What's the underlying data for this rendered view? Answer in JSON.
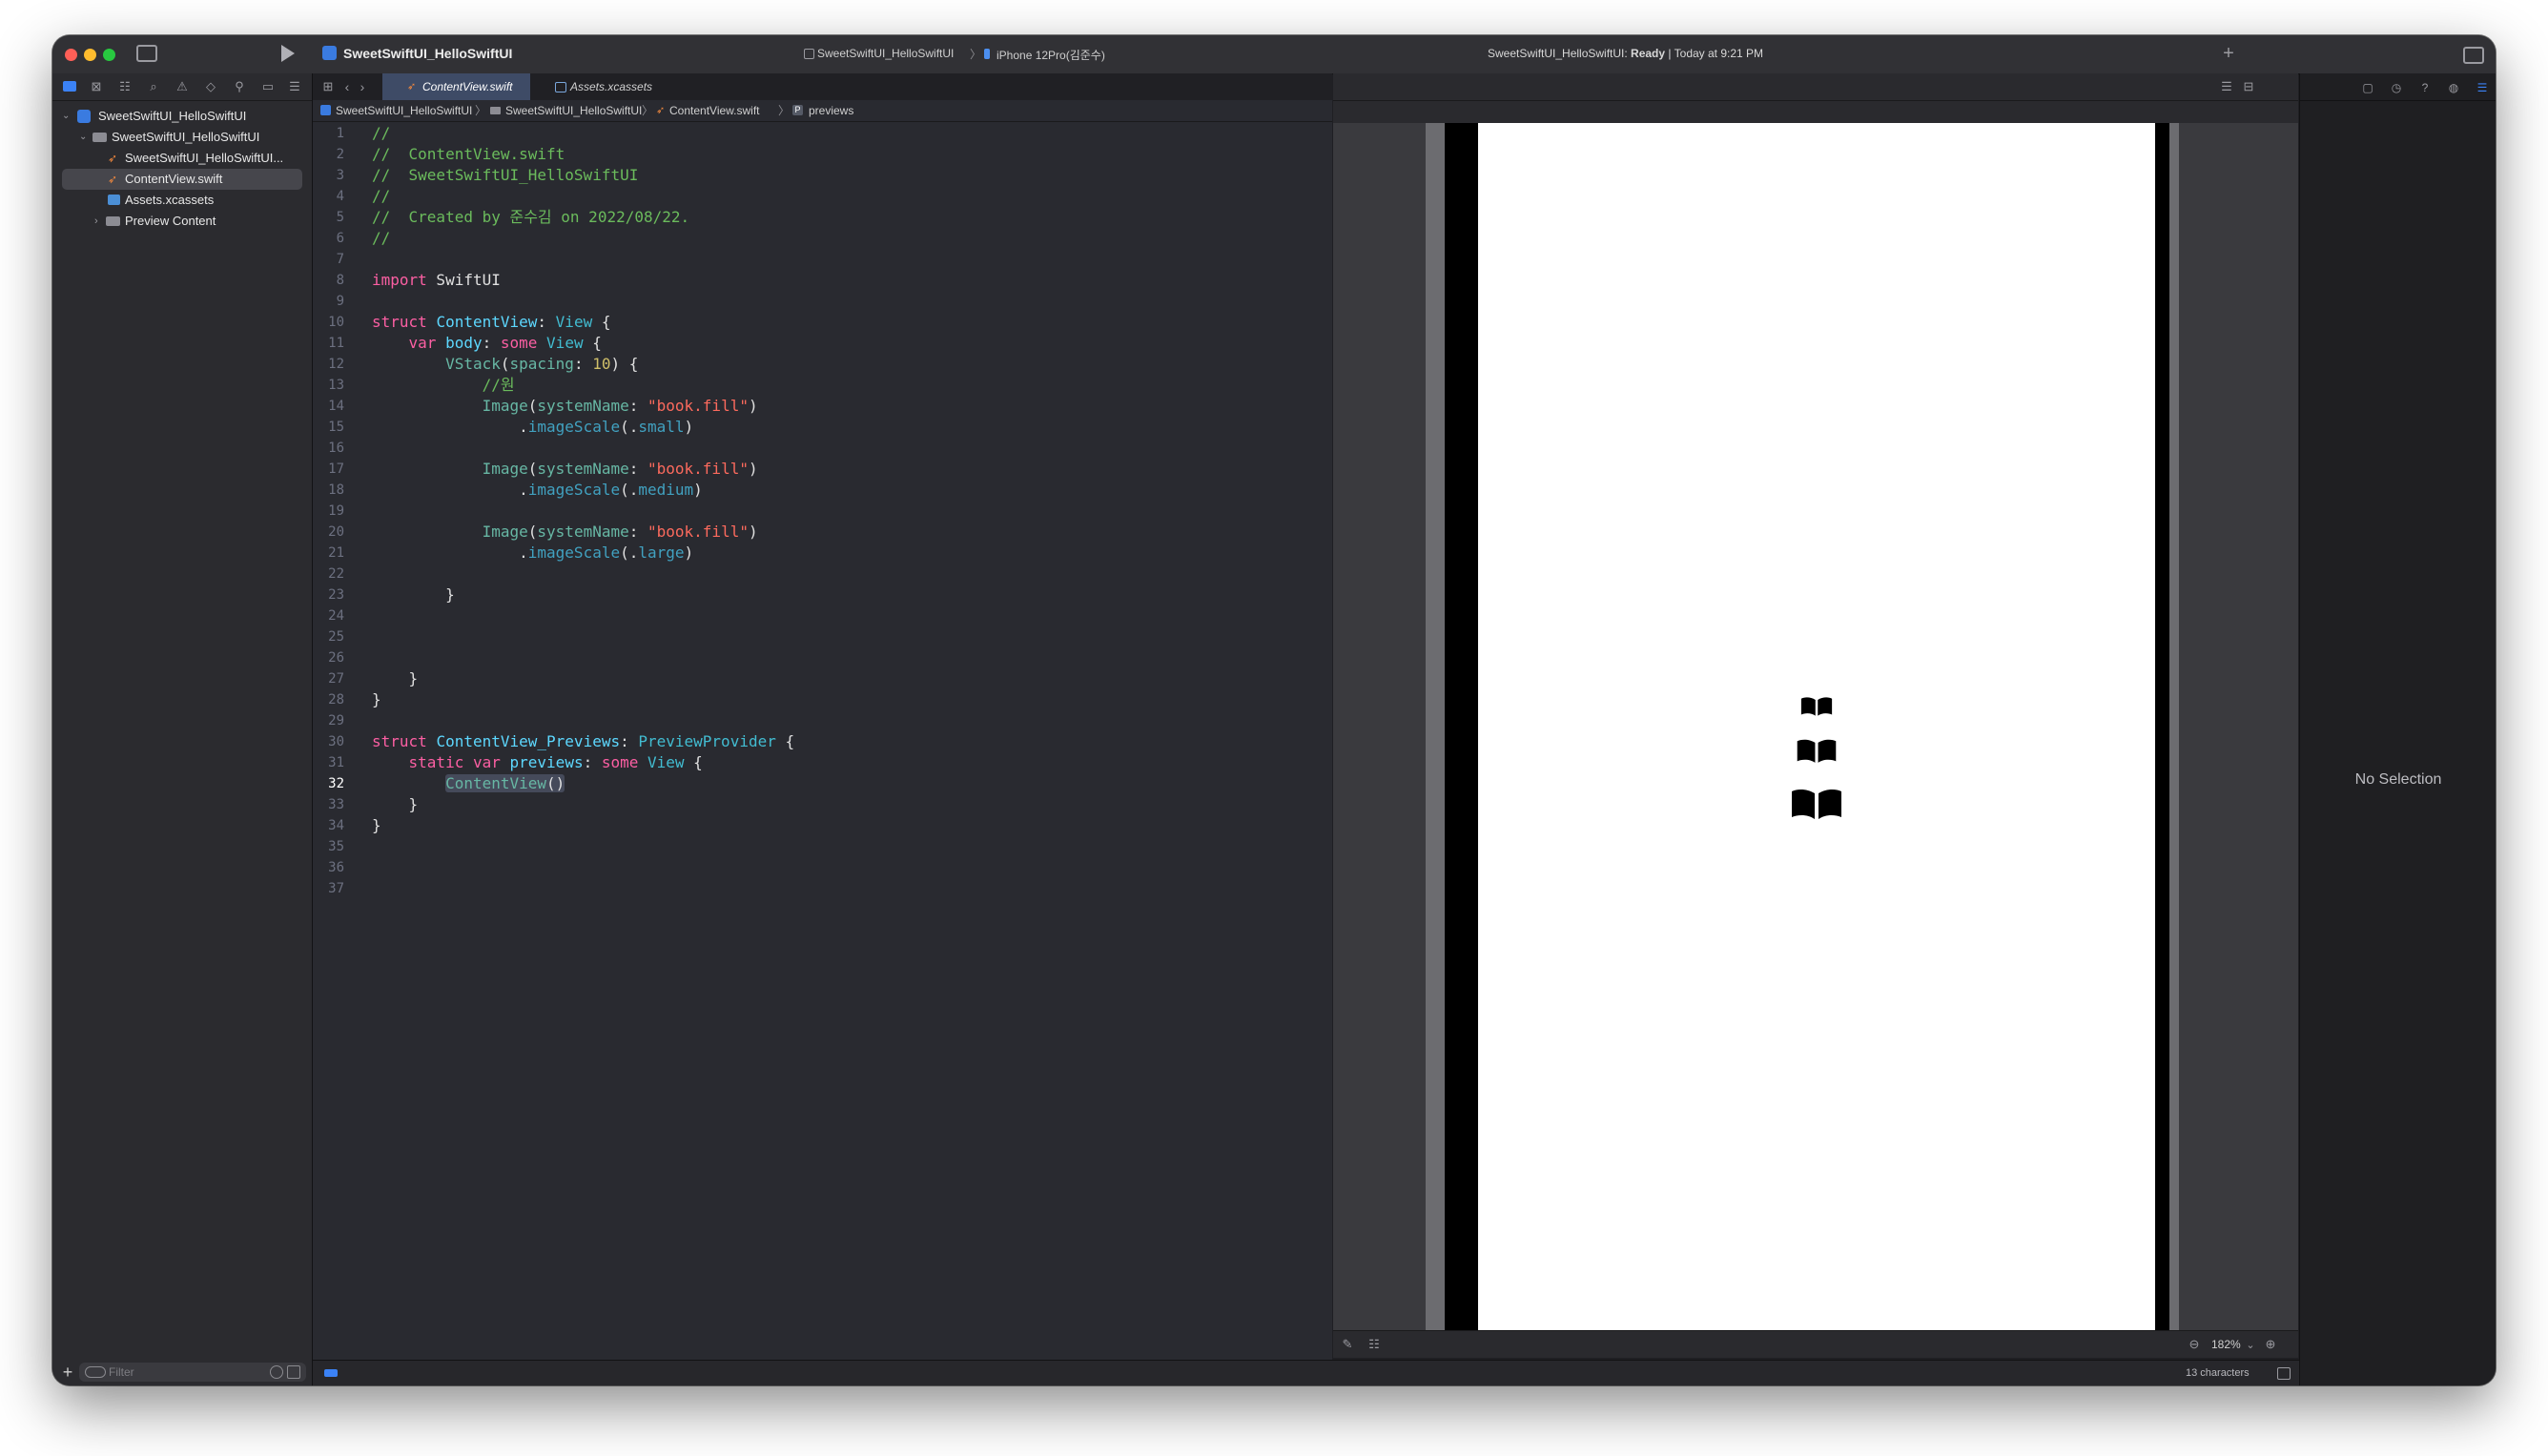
{
  "window": {
    "title": "SweetSwiftUI_HelloSwiftUI",
    "scheme": "SweetSwiftUI_HelloSwiftUI",
    "device": "iPhone 12Pro(김준수)",
    "status_prefix": "SweetSwiftUI_HelloSwiftUI: ",
    "status_ready": "Ready",
    "status_suffix": " | Today at 9:21 PM"
  },
  "navigator": {
    "items": [
      {
        "label": "SweetSwiftUI_HelloSwiftUI",
        "icon": "project-icon"
      },
      {
        "label": "SweetSwiftUI_HelloSwiftUI",
        "icon": "folder-icon"
      },
      {
        "label": "SweetSwiftUI_HelloSwiftUI...",
        "icon": "swift-file-icon"
      },
      {
        "label": "ContentView.swift",
        "icon": "swift-file-icon"
      },
      {
        "label": "Assets.xcassets",
        "icon": "asset-catalog-icon"
      },
      {
        "label": "Preview Content",
        "icon": "folder-icon"
      }
    ],
    "filter_placeholder": "Filter"
  },
  "tabs": [
    {
      "label": "ContentView.swift",
      "active": true
    },
    {
      "label": "Assets.xcassets",
      "active": false
    }
  ],
  "jumpbar": [
    "SweetSwiftUI_HelloSwiftUI",
    "SweetSwiftUI_HelloSwiftUI",
    "ContentView.swift",
    "previews"
  ],
  "code": {
    "current_line": 32,
    "lines": [
      "1",
      "2",
      "3",
      "4",
      "5",
      "6",
      "7",
      "8",
      "9",
      "10",
      "11",
      "12",
      "13",
      "14",
      "15",
      "16",
      "17",
      "18",
      "19",
      "20",
      "21",
      "22",
      "23",
      "24",
      "25",
      "26",
      "27",
      "28",
      "29",
      "30",
      "31",
      "32",
      "33",
      "34",
      "35",
      "36",
      "37"
    ]
  },
  "preview": {
    "zoom": "182%",
    "icon_name": "book.fill",
    "scales": [
      "small",
      "medium",
      "large"
    ]
  },
  "inspector": {
    "empty_text": "No Selection"
  },
  "statusbar": {
    "char_count": "13 characters"
  },
  "colors": {
    "editor_bg": "#292a30",
    "keyword": "#fc5fa3",
    "type": "#5dd8ff",
    "string": "#fc6a5d",
    "number": "#d0bf69",
    "comment": "#6bbb5c"
  }
}
